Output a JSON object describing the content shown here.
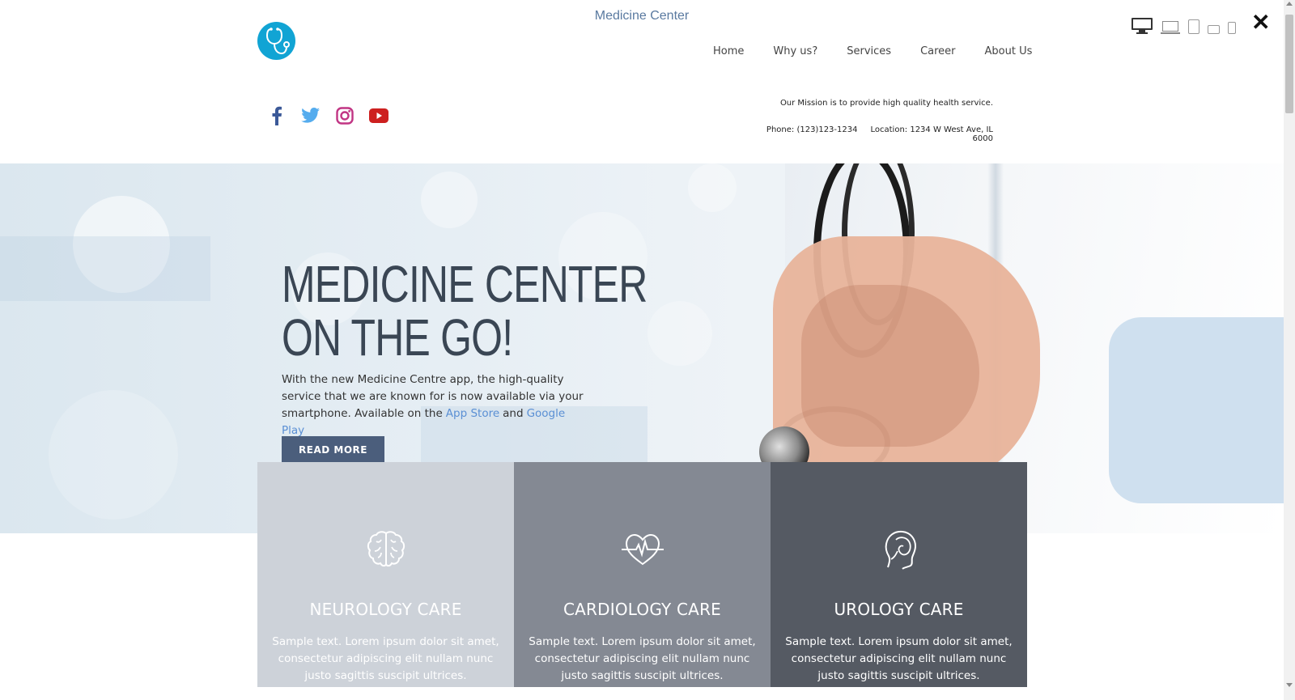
{
  "preview": {
    "title": "Medicine Center",
    "devices": [
      "desktop-icon",
      "laptop-icon",
      "tablet-icon",
      "tablet-landscape-icon",
      "phone-icon"
    ],
    "close_label": "✕"
  },
  "site": {
    "nav": [
      "Home",
      "Why us?",
      "Services",
      "Career",
      "About Us"
    ],
    "social": [
      "facebook-icon",
      "twitter-icon",
      "instagram-icon",
      "youtube-icon"
    ],
    "mission": "Our Mission is to provide high quality health service.",
    "phone": "Phone: (123)123-1234",
    "location": "Location: 1234 W West Ave, IL 6000"
  },
  "hero": {
    "title_line1": "MEDICINE CENTER",
    "title_line2": "ON THE GO!",
    "text_before": "With the new Medicine Centre app, the high-quality service that we are known for is now available via your smartphone. Available on the",
    "app_store": "App Store",
    "and": "and",
    "google_play": "Google Play",
    "button": "READ MORE"
  },
  "services": [
    {
      "title": "NEUROLOGY CARE",
      "text": "Sample text. Lorem ipsum dolor sit amet, consectetur adipiscing elit nullam nunc justo sagittis suscipit ultrices.",
      "icon": "brain-icon",
      "color": "#cdd2d9"
    },
    {
      "title": "CARDIOLOGY CARE",
      "text": "Sample text. Lorem ipsum dolor sit amet, consectetur adipiscing elit nullam nunc justo sagittis suscipit ultrices.",
      "icon": "heart-pulse-icon",
      "color": "#848993"
    },
    {
      "title": "UROLOGY CARE",
      "text": "Sample text. Lorem ipsum dolor sit amet, consectetur adipiscing elit nullam nunc justo sagittis suscipit ultrices.",
      "icon": "head-profile-icon",
      "color": "#555a63"
    }
  ],
  "colors": {
    "accent": "#11a4d4",
    "button": "#4b5e7c",
    "link": "#5a8fd4",
    "title": "#3a4654"
  }
}
